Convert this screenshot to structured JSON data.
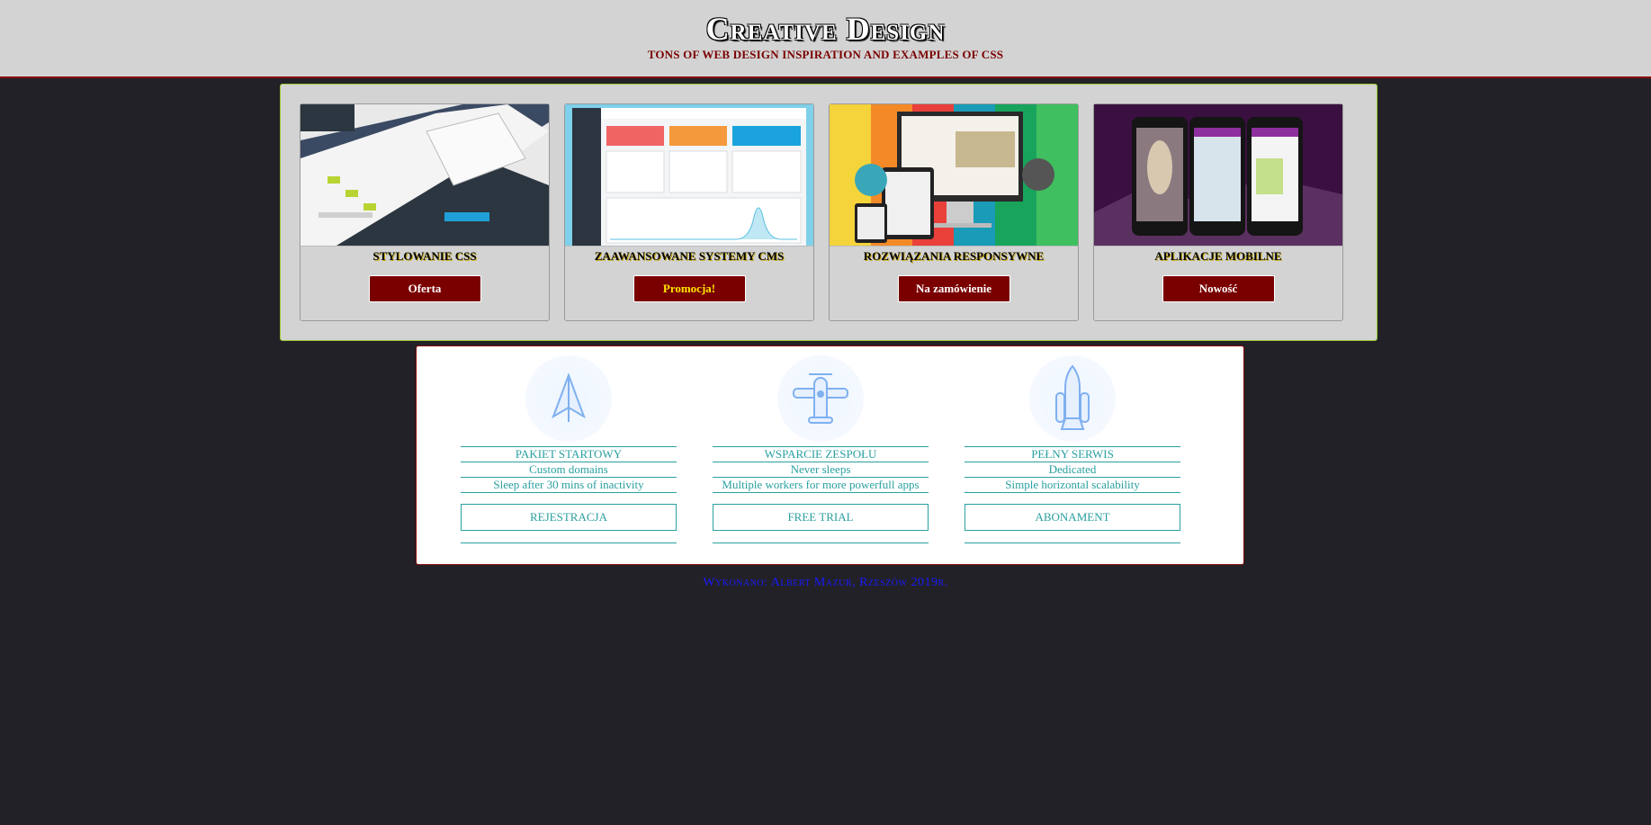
{
  "header": {
    "title": "Creative Design",
    "subtitle": "TONS OF WEB DESIGN INSPIRATION AND EXAMPLES OF CSS"
  },
  "offers": [
    {
      "title": "STYLOWANIE CSS",
      "button": "Oferta",
      "image": "css-styling-screenshot"
    },
    {
      "title": "ZAAWANSOWANE SYSTEMY CMS",
      "button": "Promocja!",
      "image": "cms-dashboard-screenshot"
    },
    {
      "title": "ROZWIĄZANIA RESPONSYWNE",
      "button": "Na zamówienie",
      "image": "responsive-devices-screenshot"
    },
    {
      "title": "APLIKACJE MOBILNE",
      "button": "Nowość",
      "image": "mobile-phones-screenshot"
    }
  ],
  "plans": [
    {
      "icon": "paper-plane-icon",
      "name": "PAKIET STARTOWY",
      "feature1": "Custom domains",
      "feature2": "Sleep after 30 mins of inactivity",
      "button": "REJESTRACJA"
    },
    {
      "icon": "airplane-icon",
      "name": "WSPARCIE ZESPOŁU",
      "feature1": "Never sleeps",
      "feature2": "Multiple workers for more powerfull apps",
      "button": "FREE TRIAL"
    },
    {
      "icon": "space-shuttle-icon",
      "name": "PEŁNY SERWIS",
      "feature1": "Dedicated",
      "feature2": "Simple horizontal scalability",
      "button": "ABONAMENT"
    }
  ],
  "footer": {
    "text": "Wykonano: Albert Mazur, Rzeszów 2019r."
  },
  "colors": {
    "page_bg": "#222127",
    "panel_bg": "#d3d3d3",
    "accent_red": "#7a0000",
    "teal": "#2aa0a0",
    "footer_blue": "#1a1aff"
  }
}
